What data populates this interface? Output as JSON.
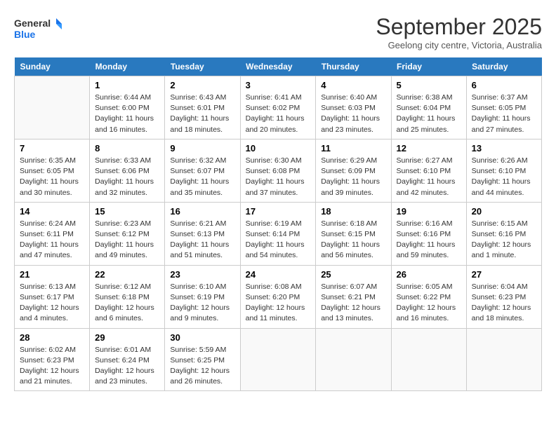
{
  "logo": {
    "general": "General",
    "blue": "Blue"
  },
  "title": "September 2025",
  "subtitle": "Geelong city centre, Victoria, Australia",
  "days_of_week": [
    "Sunday",
    "Monday",
    "Tuesday",
    "Wednesday",
    "Thursday",
    "Friday",
    "Saturday"
  ],
  "weeks": [
    [
      {
        "num": "",
        "detail": ""
      },
      {
        "num": "1",
        "detail": "Sunrise: 6:44 AM\nSunset: 6:00 PM\nDaylight: 11 hours\nand 16 minutes."
      },
      {
        "num": "2",
        "detail": "Sunrise: 6:43 AM\nSunset: 6:01 PM\nDaylight: 11 hours\nand 18 minutes."
      },
      {
        "num": "3",
        "detail": "Sunrise: 6:41 AM\nSunset: 6:02 PM\nDaylight: 11 hours\nand 20 minutes."
      },
      {
        "num": "4",
        "detail": "Sunrise: 6:40 AM\nSunset: 6:03 PM\nDaylight: 11 hours\nand 23 minutes."
      },
      {
        "num": "5",
        "detail": "Sunrise: 6:38 AM\nSunset: 6:04 PM\nDaylight: 11 hours\nand 25 minutes."
      },
      {
        "num": "6",
        "detail": "Sunrise: 6:37 AM\nSunset: 6:05 PM\nDaylight: 11 hours\nand 27 minutes."
      }
    ],
    [
      {
        "num": "7",
        "detail": "Sunrise: 6:35 AM\nSunset: 6:05 PM\nDaylight: 11 hours\nand 30 minutes."
      },
      {
        "num": "8",
        "detail": "Sunrise: 6:33 AM\nSunset: 6:06 PM\nDaylight: 11 hours\nand 32 minutes."
      },
      {
        "num": "9",
        "detail": "Sunrise: 6:32 AM\nSunset: 6:07 PM\nDaylight: 11 hours\nand 35 minutes."
      },
      {
        "num": "10",
        "detail": "Sunrise: 6:30 AM\nSunset: 6:08 PM\nDaylight: 11 hours\nand 37 minutes."
      },
      {
        "num": "11",
        "detail": "Sunrise: 6:29 AM\nSunset: 6:09 PM\nDaylight: 11 hours\nand 39 minutes."
      },
      {
        "num": "12",
        "detail": "Sunrise: 6:27 AM\nSunset: 6:10 PM\nDaylight: 11 hours\nand 42 minutes."
      },
      {
        "num": "13",
        "detail": "Sunrise: 6:26 AM\nSunset: 6:10 PM\nDaylight: 11 hours\nand 44 minutes."
      }
    ],
    [
      {
        "num": "14",
        "detail": "Sunrise: 6:24 AM\nSunset: 6:11 PM\nDaylight: 11 hours\nand 47 minutes."
      },
      {
        "num": "15",
        "detail": "Sunrise: 6:23 AM\nSunset: 6:12 PM\nDaylight: 11 hours\nand 49 minutes."
      },
      {
        "num": "16",
        "detail": "Sunrise: 6:21 AM\nSunset: 6:13 PM\nDaylight: 11 hours\nand 51 minutes."
      },
      {
        "num": "17",
        "detail": "Sunrise: 6:19 AM\nSunset: 6:14 PM\nDaylight: 11 hours\nand 54 minutes."
      },
      {
        "num": "18",
        "detail": "Sunrise: 6:18 AM\nSunset: 6:15 PM\nDaylight: 11 hours\nand 56 minutes."
      },
      {
        "num": "19",
        "detail": "Sunrise: 6:16 AM\nSunset: 6:16 PM\nDaylight: 11 hours\nand 59 minutes."
      },
      {
        "num": "20",
        "detail": "Sunrise: 6:15 AM\nSunset: 6:16 PM\nDaylight: 12 hours\nand 1 minute."
      }
    ],
    [
      {
        "num": "21",
        "detail": "Sunrise: 6:13 AM\nSunset: 6:17 PM\nDaylight: 12 hours\nand 4 minutes."
      },
      {
        "num": "22",
        "detail": "Sunrise: 6:12 AM\nSunset: 6:18 PM\nDaylight: 12 hours\nand 6 minutes."
      },
      {
        "num": "23",
        "detail": "Sunrise: 6:10 AM\nSunset: 6:19 PM\nDaylight: 12 hours\nand 9 minutes."
      },
      {
        "num": "24",
        "detail": "Sunrise: 6:08 AM\nSunset: 6:20 PM\nDaylight: 12 hours\nand 11 minutes."
      },
      {
        "num": "25",
        "detail": "Sunrise: 6:07 AM\nSunset: 6:21 PM\nDaylight: 12 hours\nand 13 minutes."
      },
      {
        "num": "26",
        "detail": "Sunrise: 6:05 AM\nSunset: 6:22 PM\nDaylight: 12 hours\nand 16 minutes."
      },
      {
        "num": "27",
        "detail": "Sunrise: 6:04 AM\nSunset: 6:23 PM\nDaylight: 12 hours\nand 18 minutes."
      }
    ],
    [
      {
        "num": "28",
        "detail": "Sunrise: 6:02 AM\nSunset: 6:23 PM\nDaylight: 12 hours\nand 21 minutes."
      },
      {
        "num": "29",
        "detail": "Sunrise: 6:01 AM\nSunset: 6:24 PM\nDaylight: 12 hours\nand 23 minutes."
      },
      {
        "num": "30",
        "detail": "Sunrise: 5:59 AM\nSunset: 6:25 PM\nDaylight: 12 hours\nand 26 minutes."
      },
      {
        "num": "",
        "detail": ""
      },
      {
        "num": "",
        "detail": ""
      },
      {
        "num": "",
        "detail": ""
      },
      {
        "num": "",
        "detail": ""
      }
    ]
  ]
}
